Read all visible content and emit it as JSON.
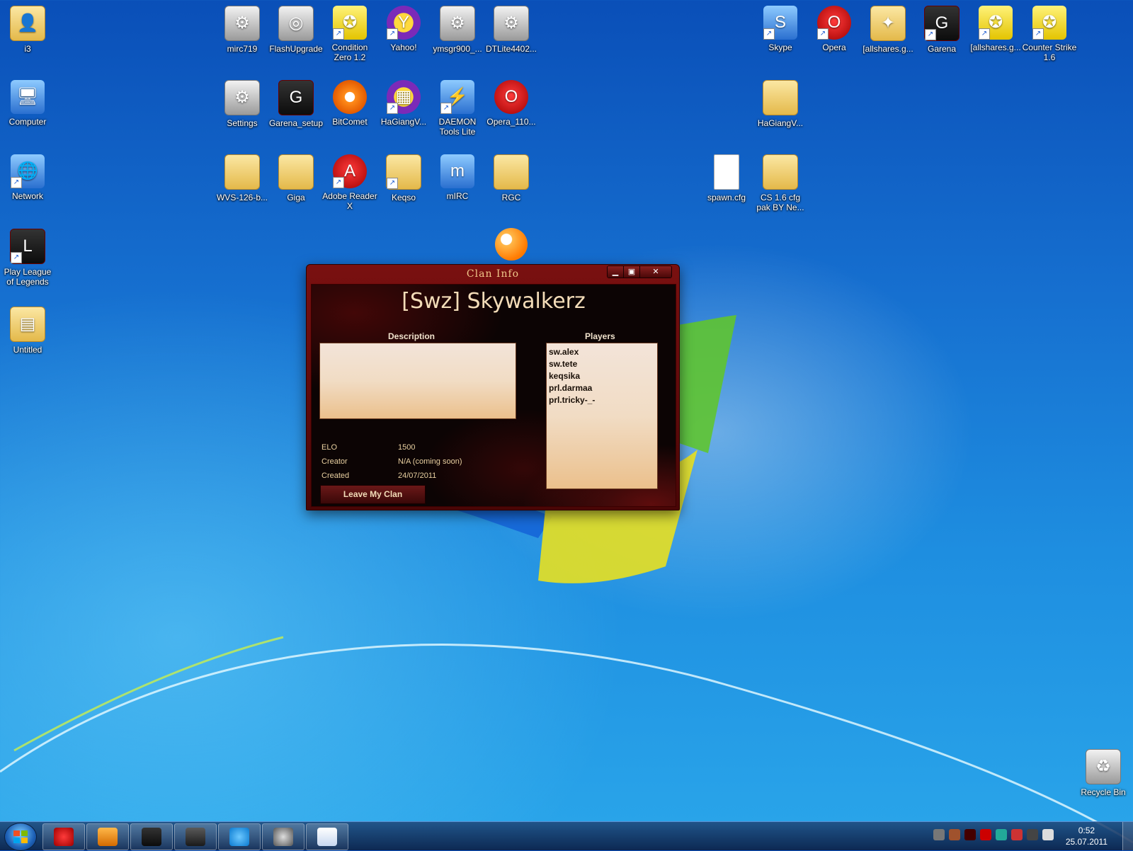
{
  "desktop_icons": [
    {
      "label": "i3",
      "icon": "user-folder-icon"
    },
    {
      "label": "Computer",
      "icon": "computer-icon"
    },
    {
      "label": "Network",
      "icon": "network-icon"
    },
    {
      "label": "Play League of Legends",
      "icon": "league-of-legends-icon"
    },
    {
      "label": "Untitled",
      "icon": "untitled-file-icon"
    },
    {
      "label": "mirc719",
      "icon": "installer-icon"
    },
    {
      "label": "FlashUpgrade",
      "icon": "film-reel-icon"
    },
    {
      "label": "Condition Zero 1.2",
      "icon": "counter-strike-icon"
    },
    {
      "label": "Yahoo!",
      "icon": "yahoo-messenger-icon"
    },
    {
      "label": "ymsgr900_...",
      "icon": "installer-icon"
    },
    {
      "label": "DTLite4402...",
      "icon": "installer-icon"
    },
    {
      "label": "Settings",
      "icon": "settings-file-icon"
    },
    {
      "label": "Garena_setup",
      "icon": "garena-icon"
    },
    {
      "label": "BitComet",
      "icon": "bitcomet-icon"
    },
    {
      "label": "HaGiangV...",
      "icon": "winrar-icon"
    },
    {
      "label": "DAEMON Tools Lite",
      "icon": "daemon-tools-icon"
    },
    {
      "label": "Opera_110...",
      "icon": "opera-installer-icon"
    },
    {
      "label": "WVS-126-b...",
      "icon": "folder-icon"
    },
    {
      "label": "Giga",
      "icon": "folder-icon"
    },
    {
      "label": "Adobe Reader X",
      "icon": "adobe-reader-icon"
    },
    {
      "label": "Keqso",
      "icon": "folder-icon"
    },
    {
      "label": "mIRC",
      "icon": "mirc-icon"
    },
    {
      "label": "RGC",
      "icon": "folder-icon"
    },
    {
      "label": "Skype",
      "icon": "skype-icon"
    },
    {
      "label": "Opera",
      "icon": "opera-icon"
    },
    {
      "label": "[allshares.g...",
      "icon": "map-file-icon"
    },
    {
      "label": "Garena",
      "icon": "garena-icon"
    },
    {
      "label": "[allshares.g...",
      "icon": "counter-strike-icon"
    },
    {
      "label": "Counter Strike 1.6",
      "icon": "counter-strike-icon"
    },
    {
      "label": "HaGiangV...",
      "icon": "folder-icon"
    },
    {
      "label": "spawn.cfg",
      "icon": "text-file-icon"
    },
    {
      "label": "CS 1.6 cfg pak BY Ne...",
      "icon": "folder-icon"
    },
    {
      "label": "Recycle Bin",
      "icon": "recycle-bin-icon"
    }
  ],
  "clan_window": {
    "title": "Clan Info",
    "clan_name": "[Swz] Skywalkerz",
    "description_label": "Description",
    "description_text": "",
    "players_label": "Players",
    "players": [
      "sw.alex",
      "sw.tete",
      "keqsika",
      "prl.darmaa",
      "prl.tricky-_-"
    ],
    "stats": [
      {
        "label": "ELO",
        "value": "1500"
      },
      {
        "label": "Creator",
        "value": "N/A (coming soon)"
      },
      {
        "label": "Created",
        "value": "24/07/2011"
      }
    ],
    "leave_button": "Leave My Clan",
    "controls": {
      "minimize": "▁",
      "maximize": "▣",
      "close": "✕"
    }
  },
  "taskbar": {
    "pinned": [
      "opera-icon",
      "media-player-icon",
      "garena-icon",
      "game-icon",
      "skype-icon",
      "steering-wheel-icon",
      "paint-icon"
    ],
    "clock_time": "0:52",
    "clock_date": "25.07.2011"
  },
  "colors": {
    "window_red": "#7a1010",
    "accent_gold": "#f0c88a"
  }
}
